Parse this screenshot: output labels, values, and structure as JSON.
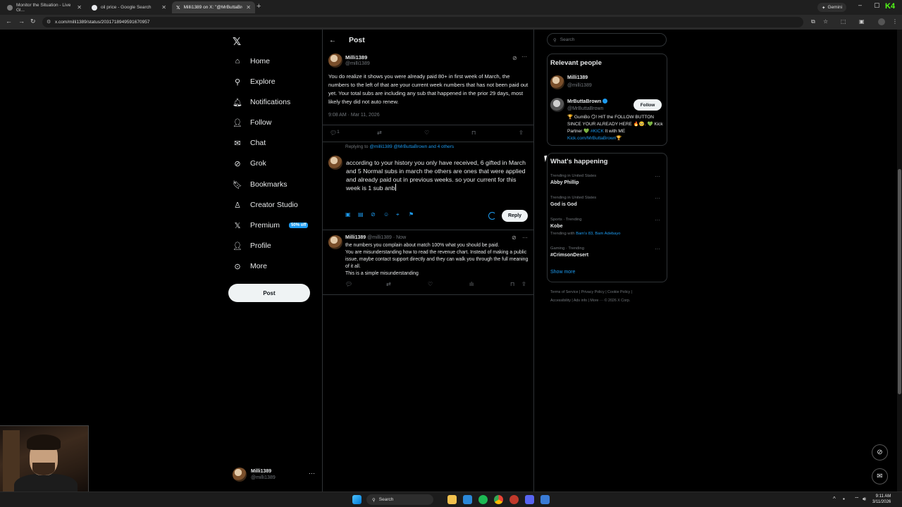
{
  "browser": {
    "tabs": [
      {
        "title": "Monitor the Situation - Live Gl..."
      },
      {
        "title": "oil price - Google Search"
      },
      {
        "title": "Milli1389 on X: \"@MrButtaBrow..."
      }
    ],
    "url": "x.com/milli1389/status/2031718949591670957",
    "gemini_label": "Gemini",
    "kick_label": "K4"
  },
  "nav": {
    "items": [
      {
        "label": "Home",
        "icon": "home-icon"
      },
      {
        "label": "Explore",
        "icon": "search-icon"
      },
      {
        "label": "Notifications",
        "icon": "bell-icon"
      },
      {
        "label": "Follow",
        "icon": "person-add-icon"
      },
      {
        "label": "Chat",
        "icon": "mail-icon"
      },
      {
        "label": "Grok",
        "icon": "grok-icon"
      },
      {
        "label": "Bookmarks",
        "icon": "bookmark-icon"
      },
      {
        "label": "Creator Studio",
        "icon": "creator-icon"
      },
      {
        "label": "Premium",
        "icon": "x-icon"
      },
      {
        "label": "Profile",
        "icon": "profile-icon"
      },
      {
        "label": "More",
        "icon": "more-circle-icon"
      }
    ],
    "premium_badge": "50% off",
    "post_button": "Post",
    "account": {
      "name": "Milli1389",
      "handle": "@milli1389"
    }
  },
  "main": {
    "header_title": "Post",
    "post": {
      "author_name": "Milli1389",
      "author_handle": "@milli1389",
      "text": "You do realize it shows you were already paid 80+ in first week of March, the numbers to the left of that are your current week numbers that has not been paid out yet. Your total subs are including any sub that happened in the prior 29 days, most likely they did not auto renew.",
      "timestamp": "9:08 AM · Mar 11, 2026",
      "reply_count": "1"
    },
    "compose": {
      "replying_prefix": "Replying to",
      "replying_targets": "@milli1389 @MrButtaBrown and 4 others",
      "text": "according to your history you only have received, 6 gifted in March and 5 Normal subs in march the others are ones that were applied and already paid out in previous weeks. so your  current for this week is 1 sub anb",
      "reply_button": "Reply"
    },
    "reply": {
      "author_name": "Milli1389",
      "author_handle": "@milli1389",
      "time": "Now",
      "lines": [
        "the numbers you complain about match 100% what you should be paid.",
        "You are misunderstanding how to read the revenue chart. Instead of making a public issue, maybe contact support directly and they can walk you through the full meaning of it all.",
        "This is a simple misunderstanding"
      ]
    }
  },
  "sidebar": {
    "search_placeholder": "Search",
    "relevant_title": "Relevant people",
    "people": [
      {
        "name": "Milli1389",
        "handle": "@milli1389"
      },
      {
        "name": "MrButtaBrown",
        "handle": "@MrButtaBrown"
      }
    ],
    "follow_label": "Follow",
    "bio_text": "🏆 GumBo 😏! HIT the FOLLOW BUTTON SINCE YOUR ALREADY HERE 🔥🥺. 💚 Kick Partner 💚 ",
    "bio_tag": "#KICK",
    "bio_text2": " It with ME ",
    "bio_link": "Kick.com/MrButtaBrown",
    "bio_end": "🏆",
    "happening_title": "What's happening",
    "trends": [
      {
        "meta": "Trending in United States",
        "name": "Abby Phillip",
        "sub": ""
      },
      {
        "meta": "Trending in United States",
        "name": "God is God",
        "sub": ""
      },
      {
        "meta": "Sports · Trending",
        "name": "Kobe",
        "sub_prefix": "Trending with ",
        "sub": "Bam's 83, Bam Adebayo"
      },
      {
        "meta": "Gaming · Trending",
        "name": "#CrimsonDesert",
        "sub": ""
      }
    ],
    "show_more": "Show more",
    "footer_line1": "Terms of Service  |  Privacy Policy  |  Cookie Policy  |",
    "footer_line2": "Accessibility  |  Ads info  |  More ···  © 2026 X Corp."
  },
  "taskbar": {
    "search_label": "Search",
    "time": "9:11 AM",
    "date": "3/11/2026"
  }
}
